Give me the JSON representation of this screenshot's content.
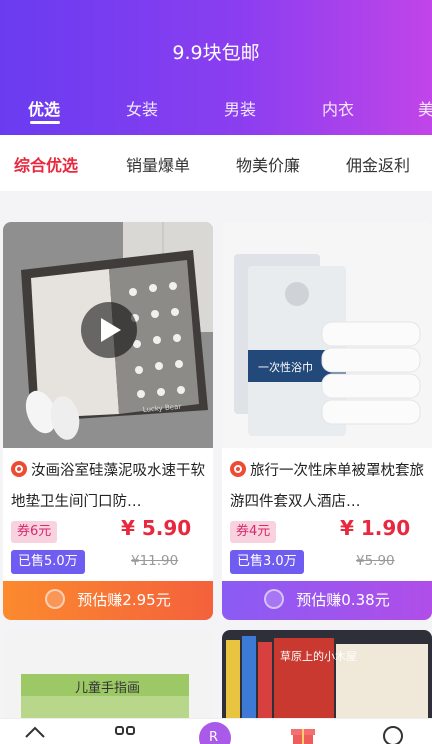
{
  "header": {
    "title": "9.9块包邮",
    "tabs": [
      "优选",
      "女装",
      "男装",
      "内衣",
      "美"
    ]
  },
  "sort": [
    "综合优选",
    "销量爆单",
    "物美价廉",
    "佣金返利"
  ],
  "products": [
    {
      "title": "汝画浴室硅藻泥吸水速干软地垫卫生间门口防…",
      "coupon": "券6元",
      "price": "¥ 5.90",
      "sold": "已售5.0万",
      "original_price": "¥11.90",
      "earn": "预估赚2.95元",
      "image_text": "Lucky Bear"
    },
    {
      "title": "旅行一次性床单被罩枕套旅游四件套双人酒店…",
      "coupon": "券4元",
      "price": "¥ 1.90",
      "sold": "已售3.0万",
      "original_price": "¥5.90",
      "earn": "预估赚0.38元",
      "image_text": "一次性浴巾"
    }
  ],
  "next_row": [
    "儿童手指画",
    "草原上的小木屋"
  ],
  "icons": [
    "home-icon",
    "category-icon",
    "r-icon",
    "gift-icon",
    "profile-icon",
    "play-icon",
    "shop-badge-icon",
    "coin-icon"
  ],
  "colors": {
    "header_start": "#6a3cf0",
    "header_end": "#c145e8",
    "price": "#e8283e",
    "sold_bg": "#6f5cf0"
  }
}
